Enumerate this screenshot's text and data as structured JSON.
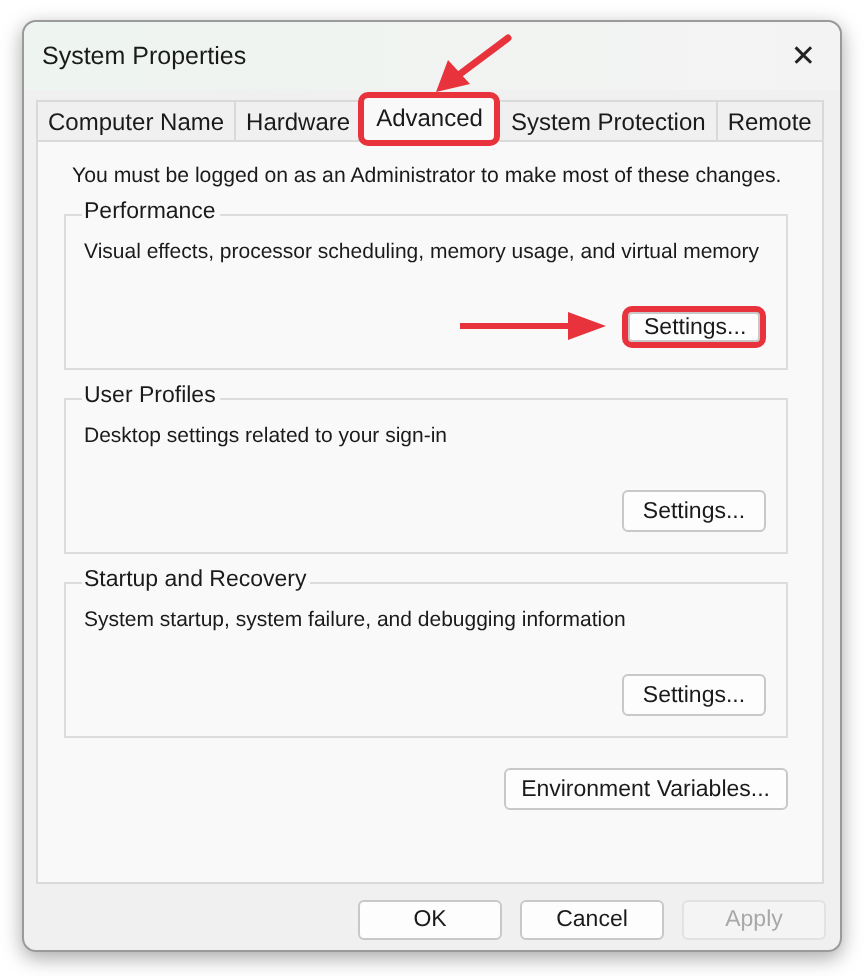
{
  "window": {
    "title": "System Properties",
    "close": "✕"
  },
  "tabs": [
    {
      "label": "Computer Name",
      "selected": false,
      "highlighted": false,
      "pointer_arrow": false
    },
    {
      "label": "Hardware",
      "selected": false,
      "highlighted": false,
      "pointer_arrow": false
    },
    {
      "label": "Advanced",
      "selected": true,
      "highlighted": true,
      "pointer_arrow": true
    },
    {
      "label": "System Protection",
      "selected": false,
      "highlighted": false,
      "pointer_arrow": false
    },
    {
      "label": "Remote",
      "selected": false,
      "highlighted": false,
      "pointer_arrow": false
    }
  ],
  "notice": "You must be logged on as an Administrator to make most of these changes.",
  "groups": [
    {
      "title": "Performance",
      "description": "Visual effects, processor scheduling, memory usage, and virtual memory",
      "button": {
        "label": "Settings...",
        "highlighted": true,
        "pointer_arrow": true
      }
    },
    {
      "title": "User Profiles",
      "description": "Desktop settings related to your sign-in",
      "button": {
        "label": "Settings...",
        "highlighted": false,
        "pointer_arrow": false
      }
    },
    {
      "title": "Startup and Recovery",
      "description": "System startup, system failure, and debugging information",
      "button": {
        "label": "Settings...",
        "highlighted": false,
        "pointer_arrow": false
      }
    }
  ],
  "environment_button": {
    "label": "Environment Variables..."
  },
  "buttons": [
    {
      "label": "OK",
      "disabled": false
    },
    {
      "label": "Cancel",
      "disabled": false
    },
    {
      "label": "Apply",
      "disabled": true
    }
  ]
}
